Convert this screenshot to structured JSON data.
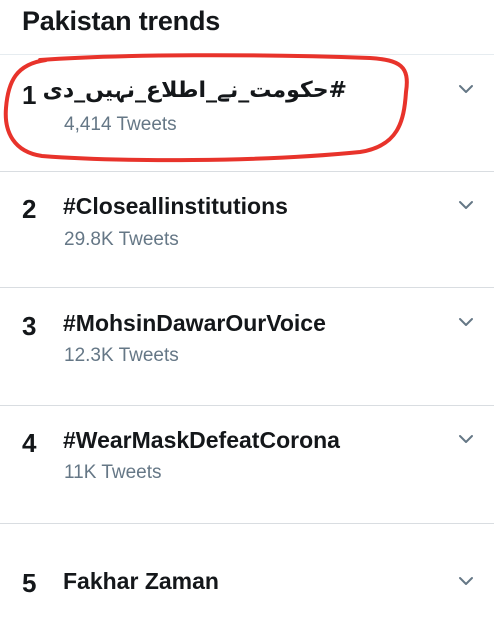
{
  "header": {
    "title": "Pakistan trends"
  },
  "trends": [
    {
      "rank": "1",
      "name": "#حکومت_نے_اطلاع_نہیں_دی",
      "count": "4,414 Tweets"
    },
    {
      "rank": "2",
      "name": "#Closeallinstitutions",
      "count": "29.8K Tweets"
    },
    {
      "rank": "3",
      "name": "#MohsinDawarOurVoice",
      "count": "12.3K Tweets"
    },
    {
      "rank": "4",
      "name": "#WearMaskDefeatCorona",
      "count": "11K Tweets"
    },
    {
      "rank": "5",
      "name": "Fakhar Zaman",
      "count": ""
    }
  ],
  "icons": {
    "more": "chevron-down-icon"
  },
  "colors": {
    "text": "#14171a",
    "secondary": "#657786",
    "divider": "#d9dde1",
    "annotation": "#e8332b"
  }
}
